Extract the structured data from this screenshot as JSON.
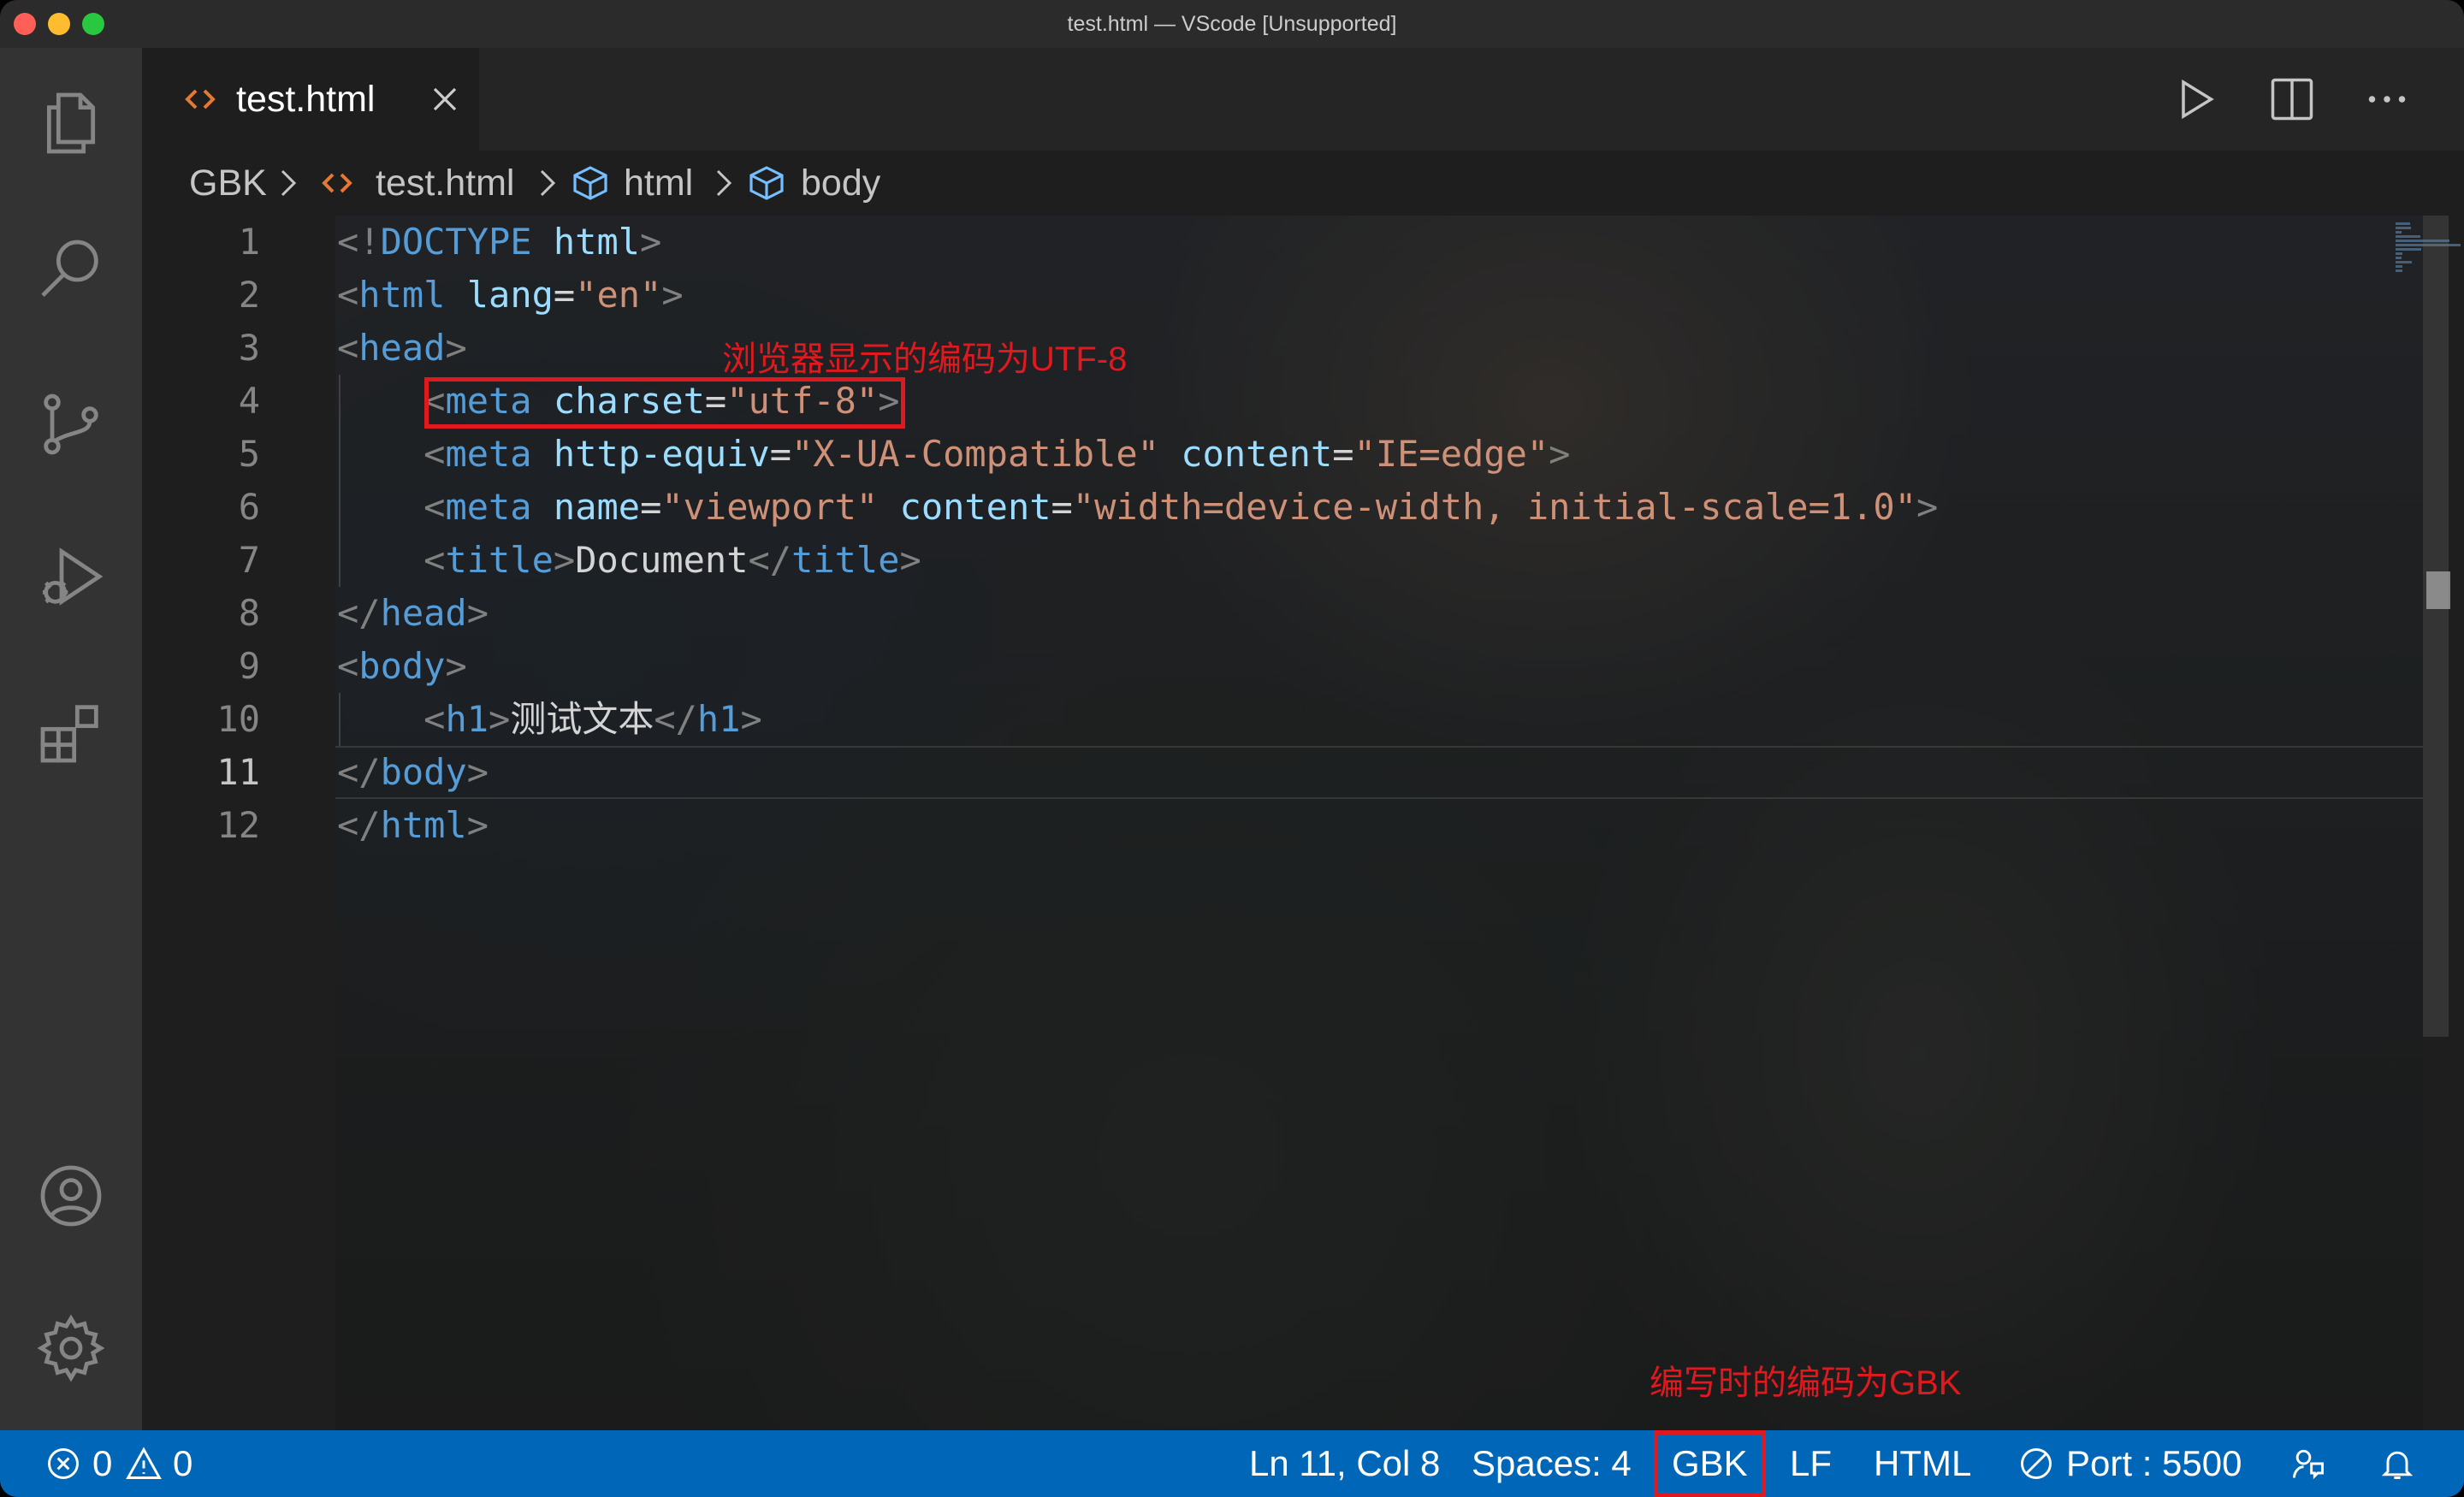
{
  "window": {
    "title": "test.html — VScode [Unsupported]"
  },
  "activity_bar": {
    "icons": [
      "files-icon",
      "search-icon",
      "source-control-icon",
      "run-debug-icon",
      "extensions-icon",
      "account-icon",
      "settings-gear-icon"
    ]
  },
  "tabs": [
    {
      "label": "test.html",
      "active": true
    }
  ],
  "editor_actions": [
    "run-icon",
    "split-editor-icon",
    "more-actions-icon"
  ],
  "breadcrumb": {
    "folder": "GBK",
    "file": "test.html",
    "symbols": [
      "html",
      "body"
    ]
  },
  "editor": {
    "active_line": 11,
    "lines": [
      {
        "n": "1",
        "tokens": [
          {
            "c": "brk",
            "t": "<!"
          },
          {
            "c": "tag",
            "t": "DOCTYPE"
          },
          {
            "c": "txt",
            "t": " "
          },
          {
            "c": "attr",
            "t": "html"
          },
          {
            "c": "brk",
            "t": ">"
          }
        ]
      },
      {
        "n": "2",
        "tokens": [
          {
            "c": "brk",
            "t": "<"
          },
          {
            "c": "tag",
            "t": "html"
          },
          {
            "c": "txt",
            "t": " "
          },
          {
            "c": "attr",
            "t": "lang"
          },
          {
            "c": "txt",
            "t": "="
          },
          {
            "c": "str",
            "t": "\"en\""
          },
          {
            "c": "brk",
            "t": ">"
          }
        ]
      },
      {
        "n": "3",
        "tokens": [
          {
            "c": "brk",
            "t": "<"
          },
          {
            "c": "tag",
            "t": "head"
          },
          {
            "c": "brk",
            "t": ">"
          }
        ]
      },
      {
        "n": "4",
        "tokens": [
          {
            "c": "txt",
            "t": "    "
          },
          {
            "c": "brk",
            "t": "<"
          },
          {
            "c": "tag",
            "t": "meta"
          },
          {
            "c": "txt",
            "t": " "
          },
          {
            "c": "attr",
            "t": "charset"
          },
          {
            "c": "txt",
            "t": "="
          },
          {
            "c": "str",
            "t": "\"utf-8\""
          },
          {
            "c": "brk",
            "t": ">"
          }
        ]
      },
      {
        "n": "5",
        "tokens": [
          {
            "c": "txt",
            "t": "    "
          },
          {
            "c": "brk",
            "t": "<"
          },
          {
            "c": "tag",
            "t": "meta"
          },
          {
            "c": "txt",
            "t": " "
          },
          {
            "c": "attr",
            "t": "http-equiv"
          },
          {
            "c": "txt",
            "t": "="
          },
          {
            "c": "str",
            "t": "\"X-UA-Compatible\""
          },
          {
            "c": "txt",
            "t": " "
          },
          {
            "c": "attr",
            "t": "content"
          },
          {
            "c": "txt",
            "t": "="
          },
          {
            "c": "str",
            "t": "\"IE=edge\""
          },
          {
            "c": "brk",
            "t": ">"
          }
        ]
      },
      {
        "n": "6",
        "tokens": [
          {
            "c": "txt",
            "t": "    "
          },
          {
            "c": "brk",
            "t": "<"
          },
          {
            "c": "tag",
            "t": "meta"
          },
          {
            "c": "txt",
            "t": " "
          },
          {
            "c": "attr",
            "t": "name"
          },
          {
            "c": "txt",
            "t": "="
          },
          {
            "c": "str",
            "t": "\"viewport\""
          },
          {
            "c": "txt",
            "t": " "
          },
          {
            "c": "attr",
            "t": "content"
          },
          {
            "c": "txt",
            "t": "="
          },
          {
            "c": "str",
            "t": "\"width=device-width, initial-scale=1.0\""
          },
          {
            "c": "brk",
            "t": ">"
          }
        ]
      },
      {
        "n": "7",
        "tokens": [
          {
            "c": "txt",
            "t": "    "
          },
          {
            "c": "brk",
            "t": "<"
          },
          {
            "c": "tag",
            "t": "title"
          },
          {
            "c": "brk",
            "t": ">"
          },
          {
            "c": "txt",
            "t": "Document"
          },
          {
            "c": "brk",
            "t": "</"
          },
          {
            "c": "tag",
            "t": "title"
          },
          {
            "c": "brk",
            "t": ">"
          }
        ]
      },
      {
        "n": "8",
        "tokens": [
          {
            "c": "brk",
            "t": "</"
          },
          {
            "c": "tag",
            "t": "head"
          },
          {
            "c": "brk",
            "t": ">"
          }
        ]
      },
      {
        "n": "9",
        "tokens": [
          {
            "c": "brk",
            "t": "<"
          },
          {
            "c": "tag",
            "t": "body"
          },
          {
            "c": "brk",
            "t": ">"
          }
        ]
      },
      {
        "n": "10",
        "tokens": [
          {
            "c": "txt",
            "t": "    "
          },
          {
            "c": "brk",
            "t": "<"
          },
          {
            "c": "tag",
            "t": "h1"
          },
          {
            "c": "brk",
            "t": ">"
          },
          {
            "c": "txt",
            "t": "测试文本"
          },
          {
            "c": "brk",
            "t": "</"
          },
          {
            "c": "tag",
            "t": "h1"
          },
          {
            "c": "brk",
            "t": ">"
          }
        ]
      },
      {
        "n": "11",
        "tokens": [
          {
            "c": "brk",
            "t": "</"
          },
          {
            "c": "tag",
            "t": "body"
          },
          {
            "c": "brk",
            "t": ">"
          }
        ]
      },
      {
        "n": "12",
        "tokens": [
          {
            "c": "brk",
            "t": "</"
          },
          {
            "c": "tag",
            "t": "html"
          },
          {
            "c": "brk",
            "t": ">"
          }
        ]
      }
    ]
  },
  "annotations": {
    "browser_encoding": "浏览器显示的编码为UTF-8",
    "writing_encoding": "编写时的编码为GBK"
  },
  "statusbar": {
    "errors": "0",
    "warnings": "0",
    "position": "Ln 11, Col 8",
    "spaces": "Spaces: 4",
    "encoding": "GBK",
    "eol": "LF",
    "language": "HTML",
    "port": "Port : 5500",
    "icons": [
      "error-icon",
      "warning-icon",
      "port-icon",
      "feedback-icon",
      "bell-icon"
    ]
  },
  "colors": {
    "statusbar_bg": "#0066b8",
    "annotation_red": "#e0191e",
    "tag_blue": "#569cd6",
    "attr_lightblue": "#9cdcfe",
    "string_orange": "#ce9178",
    "html_icon_orange": "#e37933"
  }
}
